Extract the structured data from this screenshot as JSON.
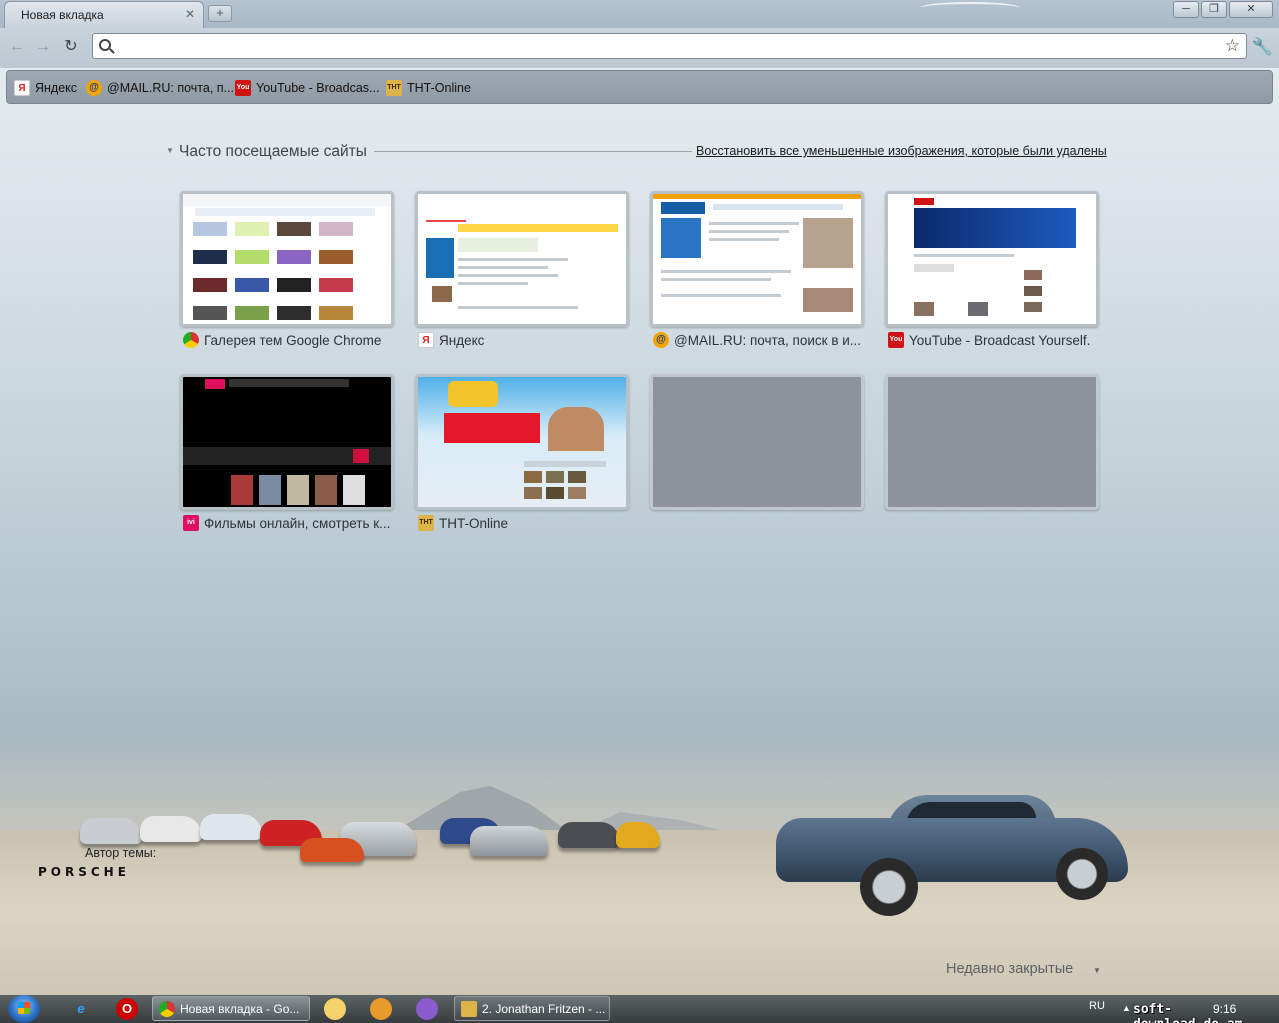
{
  "window": {
    "tab_title": "Новая вкладка",
    "tab_close": "✕",
    "new_tab": "+",
    "minimize": "─",
    "maximize": "❐",
    "close": "✕"
  },
  "toolbar": {
    "back": "←",
    "forward": "→",
    "reload": "↻",
    "omnibox_value": "",
    "star": "☆",
    "wrench": "🔧"
  },
  "bookmarks": [
    {
      "label": "Яндекс",
      "icon": "yandex-icon",
      "badge": "Я"
    },
    {
      "label": "@MAIL.RU: почта, п...",
      "icon": "mailru-icon",
      "badge": "@"
    },
    {
      "label": "YouTube - Broadcas...",
      "icon": "youtube-icon",
      "badge": "You"
    },
    {
      "label": "THT-Online",
      "icon": "tnt-icon",
      "badge": "THT"
    }
  ],
  "newtab": {
    "section_arrow": "▼",
    "section_title": "Часто посещаемые сайты",
    "restore_link": "Восстановить все уменьшенные изображения, которые были удалены",
    "thumbnails": [
      {
        "label": "Галерея тем Google Chrome",
        "icon": "chrome-icon",
        "badge": ""
      },
      {
        "label": "Яндекс",
        "icon": "yandex-icon",
        "badge": "Я"
      },
      {
        "label": "@MAIL.RU: почта, поиск в и...",
        "icon": "mailru-icon",
        "badge": "@"
      },
      {
        "label": "YouTube - Broadcast Yourself.",
        "icon": "youtube-icon",
        "badge": "You"
      },
      {
        "label": "Фильмы онлайн, смотреть к...",
        "icon": "ivi-icon",
        "badge": "ivi"
      },
      {
        "label": "THT-Online",
        "icon": "tnt-icon",
        "badge": "THT"
      },
      {
        "label": "",
        "icon": "",
        "badge": ""
      },
      {
        "label": "",
        "icon": "",
        "badge": ""
      }
    ],
    "theme_author_label": "Автор темы:",
    "theme_author_logo": "PORSCHE",
    "recently_closed": "Недавно закрытые",
    "recently_closed_arrow": "▼"
  },
  "taskbar": {
    "tasks": [
      {
        "label": "Новая вкладка - Go...",
        "active": true
      },
      {
        "label": "2. Jonathan Fritzen - ...",
        "active": false
      }
    ],
    "language": "RU",
    "tray_arrow": "▲",
    "clock": "9:16",
    "watermark": "soft-download.do.am"
  }
}
